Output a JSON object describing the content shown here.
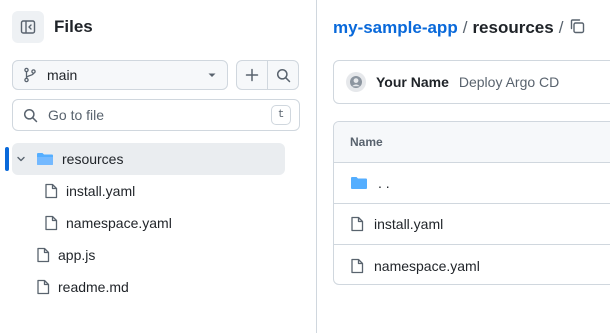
{
  "sidebar": {
    "title": "Files",
    "branch": {
      "label": "main"
    },
    "search": {
      "placeholder": "Go to file",
      "shortcut": "t"
    },
    "tree": [
      {
        "label": "resources",
        "type": "folder",
        "expanded": true,
        "selected": true
      },
      {
        "label": "install.yaml",
        "type": "file"
      },
      {
        "label": "namespace.yaml",
        "type": "file"
      },
      {
        "label": "app.js",
        "type": "file"
      },
      {
        "label": "readme.md",
        "type": "file"
      }
    ]
  },
  "main": {
    "breadcrumb": {
      "repo": "my-sample-app",
      "separator": "/",
      "path": "resources"
    },
    "commit": {
      "author": "Your Name",
      "message": "Deploy Argo CD"
    },
    "table": {
      "header": "Name",
      "rows": [
        {
          "label": ". .",
          "type": "folder"
        },
        {
          "label": "install.yaml",
          "type": "file"
        },
        {
          "label": "namespace.yaml",
          "type": "file"
        }
      ]
    }
  },
  "colors": {
    "accent": "#0969da",
    "folder": "#54aeff",
    "border": "#d0d7de",
    "muted": "#59636e"
  }
}
